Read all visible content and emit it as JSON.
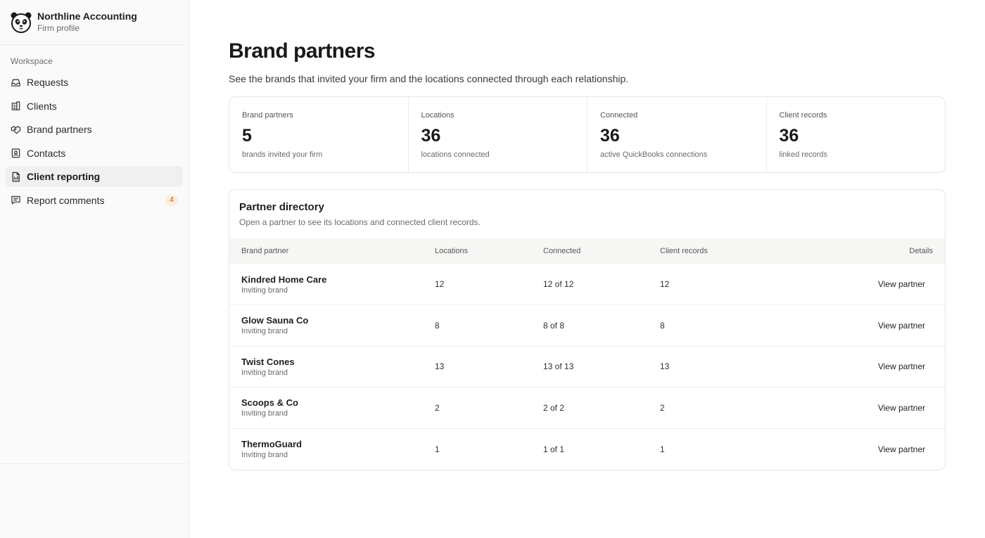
{
  "firm": {
    "name": "Northline Accounting",
    "subtitle": "Firm profile"
  },
  "sidebar": {
    "section_label": "Workspace",
    "items": [
      {
        "label": "Requests",
        "icon": "inbox-icon"
      },
      {
        "label": "Clients",
        "icon": "building-icon"
      },
      {
        "label": "Brand partners",
        "icon": "handshake-icon"
      },
      {
        "label": "Contacts",
        "icon": "contact-icon"
      },
      {
        "label": "Client reporting",
        "icon": "document-icon",
        "active": true
      },
      {
        "label": "Report comments",
        "icon": "comment-icon",
        "badge": "4"
      }
    ]
  },
  "page": {
    "title": "Brand partners",
    "description": "See the brands that invited your firm and the locations connected through each relationship."
  },
  "stats": [
    {
      "label": "Brand partners",
      "value": "5",
      "sub": "brands invited your firm"
    },
    {
      "label": "Locations",
      "value": "36",
      "sub": "locations connected"
    },
    {
      "label": "Connected",
      "value": "36",
      "sub": "active QuickBooks connections"
    },
    {
      "label": "Client records",
      "value": "36",
      "sub": "linked records"
    }
  ],
  "directory": {
    "title": "Partner directory",
    "subtitle": "Open a partner to see its locations and connected client records.",
    "columns": [
      "Brand partner",
      "Locations",
      "Connected",
      "Client records",
      "Details"
    ],
    "rows": [
      {
        "name": "Kindred Home Care",
        "type": "Inviting brand",
        "locations": "12",
        "connected": "12 of 12",
        "records": "12",
        "action": "View partner"
      },
      {
        "name": "Glow Sauna Co",
        "type": "Inviting brand",
        "locations": "8",
        "connected": "8 of 8",
        "records": "8",
        "action": "View partner"
      },
      {
        "name": "Twist Cones",
        "type": "Inviting brand",
        "locations": "13",
        "connected": "13 of 13",
        "records": "13",
        "action": "View partner"
      },
      {
        "name": "Scoops & Co",
        "type": "Inviting brand",
        "locations": "2",
        "connected": "2 of 2",
        "records": "2",
        "action": "View partner"
      },
      {
        "name": "ThermoGuard",
        "type": "Inviting brand",
        "locations": "1",
        "connected": "1 of 1",
        "records": "1",
        "action": "View partner"
      }
    ]
  },
  "colors": {
    "accent_badge": "#b45309",
    "badge_bg": "#fdecd7"
  }
}
